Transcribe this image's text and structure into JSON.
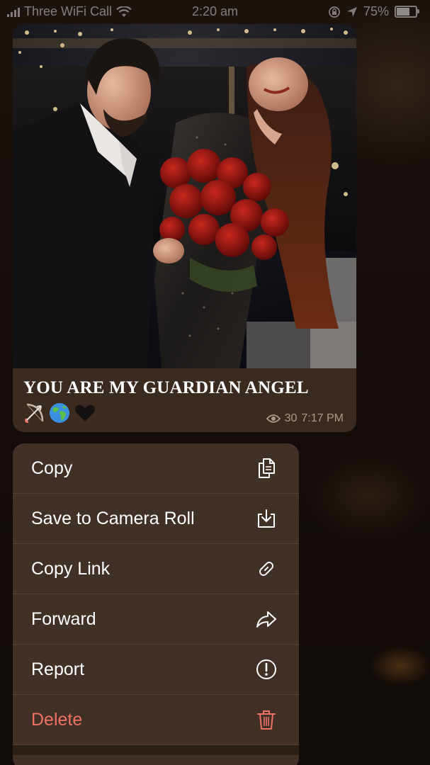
{
  "status_bar": {
    "carrier": "Three WiFi Call",
    "time": "2:20 am",
    "battery": "75%",
    "battery_level": 0.75
  },
  "message": {
    "caption": "YOU ARE MY GUARDIAN ANGEL",
    "emojis": [
      "bow-and-arrow",
      "globe",
      "black-heart"
    ],
    "views": "30",
    "time": "7:17 PM"
  },
  "context_menu": {
    "items": [
      {
        "label": "Copy",
        "icon": "copy-icon"
      },
      {
        "label": "Save to Camera Roll",
        "icon": "save-download-icon"
      },
      {
        "label": "Copy Link",
        "icon": "link-icon"
      },
      {
        "label": "Forward",
        "icon": "forward-arrow-icon"
      },
      {
        "label": "Report",
        "icon": "report-exclamation-icon"
      },
      {
        "label": "Delete",
        "icon": "trash-icon",
        "color": "#ef6f62"
      }
    ]
  },
  "colors": {
    "bubble": "#3a2a1f",
    "menu": "#443428",
    "danger": "#ef6f62",
    "meta_text": "#a99a8c"
  }
}
